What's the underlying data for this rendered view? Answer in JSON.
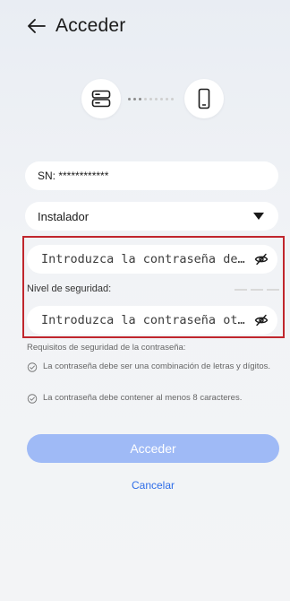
{
  "header": {
    "title": "Acceder",
    "back_icon": "arrow-left-icon"
  },
  "connection_graphic": {
    "left_icon": "server-device-icon",
    "right_icon": "phone-device-icon"
  },
  "sn_field": {
    "value": "SN: ************"
  },
  "role_select": {
    "selected": "Instalador",
    "icon": "dropdown-caret-icon"
  },
  "password": {
    "placeholder": "Introduzca la contraseña de i…",
    "toggle_icon": "eye-off-icon"
  },
  "security_level": {
    "label": "Nivel de seguridad:"
  },
  "confirm_password": {
    "placeholder": "Introduzca la contraseña otra…",
    "toggle_icon": "eye-off-icon"
  },
  "requirements": {
    "title": "Requisitos de seguridad de la contraseña:",
    "items": [
      "La contraseña debe ser una combinación de letras y dígitos.",
      "La contraseña debe contener al menos 8 caracteres."
    ]
  },
  "actions": {
    "submit_label": "Acceder",
    "cancel_label": "Cancelar"
  },
  "colors": {
    "accent": "#2f6ee8",
    "button_disabled": "#9fbaf6",
    "highlight_border": "#c0262d"
  }
}
